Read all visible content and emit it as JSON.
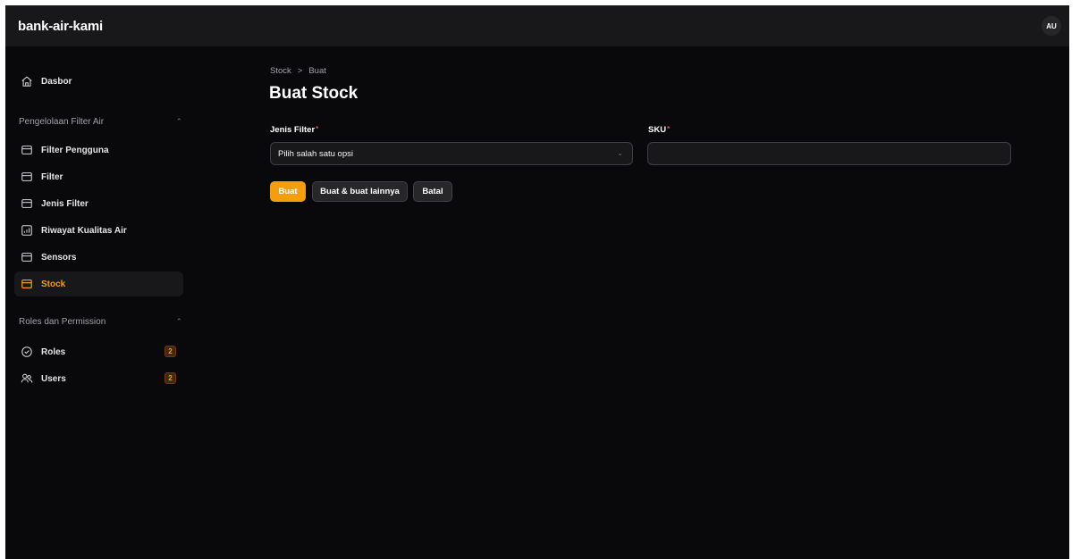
{
  "app": {
    "title": "bank-air-kami",
    "user_initials": "AU"
  },
  "sidebar": {
    "dashboard_label": "Dasbor",
    "groups": [
      {
        "label": "Pengelolaan Filter Air",
        "items": [
          {
            "label": "Filter Pengguna",
            "icon": "box-icon",
            "active": false
          },
          {
            "label": "Filter",
            "icon": "box-icon",
            "active": false
          },
          {
            "label": "Jenis Filter",
            "icon": "box-icon",
            "active": false
          },
          {
            "label": "Riwayat Kualitas Air",
            "icon": "chart-icon",
            "active": false
          },
          {
            "label": "Sensors",
            "icon": "box-icon",
            "active": false
          },
          {
            "label": "Stock",
            "icon": "box-icon",
            "active": true
          }
        ]
      },
      {
        "label": "Roles dan Permission",
        "items": [
          {
            "label": "Roles",
            "icon": "shield-check-icon",
            "badge": "2"
          },
          {
            "label": "Users",
            "icon": "users-icon",
            "badge": "2"
          }
        ]
      }
    ]
  },
  "breadcrumb": {
    "parent": "Stock",
    "separator": ">",
    "current": "Buat"
  },
  "page": {
    "title": "Buat Stock"
  },
  "form": {
    "jenis_filter": {
      "label": "Jenis Filter",
      "required_mark": "*",
      "value": "Pilih salah satu opsi"
    },
    "sku": {
      "label": "SKU",
      "required_mark": "*",
      "value": ""
    }
  },
  "actions": {
    "create_label": "Buat",
    "create_another_label": "Buat & buat lainnya",
    "cancel_label": "Batal"
  },
  "colors": {
    "accent": "#f59e0b",
    "background": "#09090b",
    "panel": "#18181b",
    "required": "#ef4444"
  }
}
